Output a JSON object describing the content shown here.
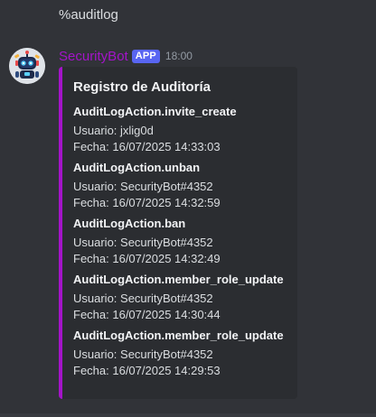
{
  "previous_message": {
    "text": "%auditlog"
  },
  "message": {
    "author": "SecurityBot",
    "badge": "APP",
    "timestamp": "18:00",
    "accent_color": "#a414c9",
    "avatar_icon": "robot-avatar-icon",
    "embed": {
      "title": "Registro de Auditoría",
      "entries": [
        {
          "action": "AuditLogAction.invite_create",
          "user": "Usuario: jxlig0d",
          "date": "Fecha: 16/07/2025 14:33:03"
        },
        {
          "action": "AuditLogAction.unban",
          "user": "Usuario: SecurityBot#4352",
          "date": "Fecha: 16/07/2025 14:32:59"
        },
        {
          "action": "AuditLogAction.ban",
          "user": "Usuario: SecurityBot#4352",
          "date": "Fecha: 16/07/2025 14:32:49"
        },
        {
          "action": "AuditLogAction.member_role_update",
          "user": "Usuario: SecurityBot#4352",
          "date": "Fecha: 16/07/2025 14:30:44"
        },
        {
          "action": "AuditLogAction.member_role_update",
          "user": "Usuario: SecurityBot#4352",
          "date": "Fecha: 16/07/2025 14:29:53"
        }
      ]
    }
  }
}
